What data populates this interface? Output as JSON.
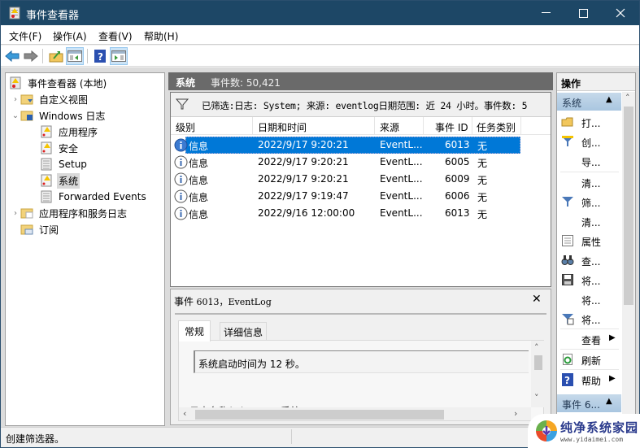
{
  "window": {
    "title": "事件查看器",
    "controls": {
      "minimize": "—",
      "maximize": "☐",
      "close": "✕"
    }
  },
  "menu": [
    "文件(F)",
    "操作(A)",
    "查看(V)",
    "帮助(H)"
  ],
  "toolbar": {
    "buttons": [
      "back-icon",
      "forward-icon",
      "up-folder-icon",
      "show-hide-tree-icon",
      "help-icon",
      "show-hide-action-pane-icon"
    ]
  },
  "tree": {
    "items": [
      {
        "label": "事件查看器 (本地)",
        "icon": "event-viewer-icon",
        "expander": ""
      },
      {
        "label": "自定义视图",
        "icon": "folder-filter-icon",
        "expander": "›"
      },
      {
        "label": "Windows 日志",
        "icon": "folder-log-icon",
        "expander": "⌄"
      },
      {
        "label": "应用程序",
        "icon": "log-warning-icon",
        "expander": ""
      },
      {
        "label": "安全",
        "icon": "log-warning-icon",
        "expander": ""
      },
      {
        "label": "Setup",
        "icon": "log-plain-icon",
        "expander": ""
      },
      {
        "label": "系统",
        "icon": "log-warning-icon",
        "expander": "",
        "selected": true
      },
      {
        "label": "Forwarded Events",
        "icon": "log-plain-icon",
        "expander": ""
      },
      {
        "label": "应用程序和服务日志",
        "icon": "folder-icon",
        "expander": "›"
      },
      {
        "label": "订阅",
        "icon": "folder-subscription-icon",
        "expander": ""
      }
    ]
  },
  "main": {
    "header": {
      "title": "系统",
      "count": "事件数: 50,421"
    },
    "filter_text": "已筛选:日志: System; 来源: eventlog日期范围: 近 24 小时。事件数: 5",
    "columns": [
      "级别",
      "日期和时间",
      "来源",
      "事件 ID",
      "任务类别"
    ],
    "rows": [
      {
        "level": "信息",
        "datetime": "2022/9/17 9:20:21",
        "source": "EventL...",
        "id": "6013",
        "task": "无",
        "selected": true
      },
      {
        "level": "信息",
        "datetime": "2022/9/17 9:20:21",
        "source": "EventL...",
        "id": "6005",
        "task": "无"
      },
      {
        "level": "信息",
        "datetime": "2022/9/17 9:20:21",
        "source": "EventL...",
        "id": "6009",
        "task": "无"
      },
      {
        "level": "信息",
        "datetime": "2022/9/17 9:19:47",
        "source": "EventL...",
        "id": "6006",
        "task": "无"
      },
      {
        "level": "信息",
        "datetime": "2022/9/16 12:00:00",
        "source": "EventL...",
        "id": "6013",
        "task": "无"
      }
    ]
  },
  "detail": {
    "title_prefix": "事件",
    "title_rest": " 6013，EventLog",
    "close": "✕",
    "tabs": [
      "常规",
      "详细信息"
    ],
    "message": "系统启动时间为 12 秒。",
    "log_name_label": "日志名称(M):",
    "log_name_value": "系统"
  },
  "actions": {
    "header": "操作",
    "group1": "系统",
    "items": [
      {
        "label": "打...",
        "icon": "open-folder-icon"
      },
      {
        "label": "创...",
        "icon": "create-filter-icon"
      },
      {
        "label": "导...",
        "icon": ""
      },
      {
        "label": "清...",
        "icon": ""
      },
      {
        "label": "筛...",
        "icon": "filter-icon"
      },
      {
        "label": "清...",
        "icon": ""
      },
      {
        "label": "属性",
        "icon": "properties-icon"
      },
      {
        "label": "查...",
        "icon": "find-icon"
      },
      {
        "label": "将...",
        "icon": "save-icon"
      },
      {
        "label": "将...",
        "icon": ""
      },
      {
        "label": "将...",
        "icon": "attach-task-icon"
      },
      {
        "label": "查看",
        "icon": "",
        "submenu": true
      },
      {
        "label": "刷新",
        "icon": "refresh-icon"
      },
      {
        "label": "帮助",
        "icon": "help-icon",
        "submenu": true
      }
    ],
    "group2": "事件 6..."
  },
  "status": "创建筛选器。",
  "watermark": {
    "title": "纯净系统家园",
    "url": "www.yidaimei.com"
  },
  "colors": {
    "titlebar": "#1d4766",
    "selection": "#0078d7",
    "header_bar": "#6a6a6a",
    "action_group": "#b8cfe5"
  }
}
